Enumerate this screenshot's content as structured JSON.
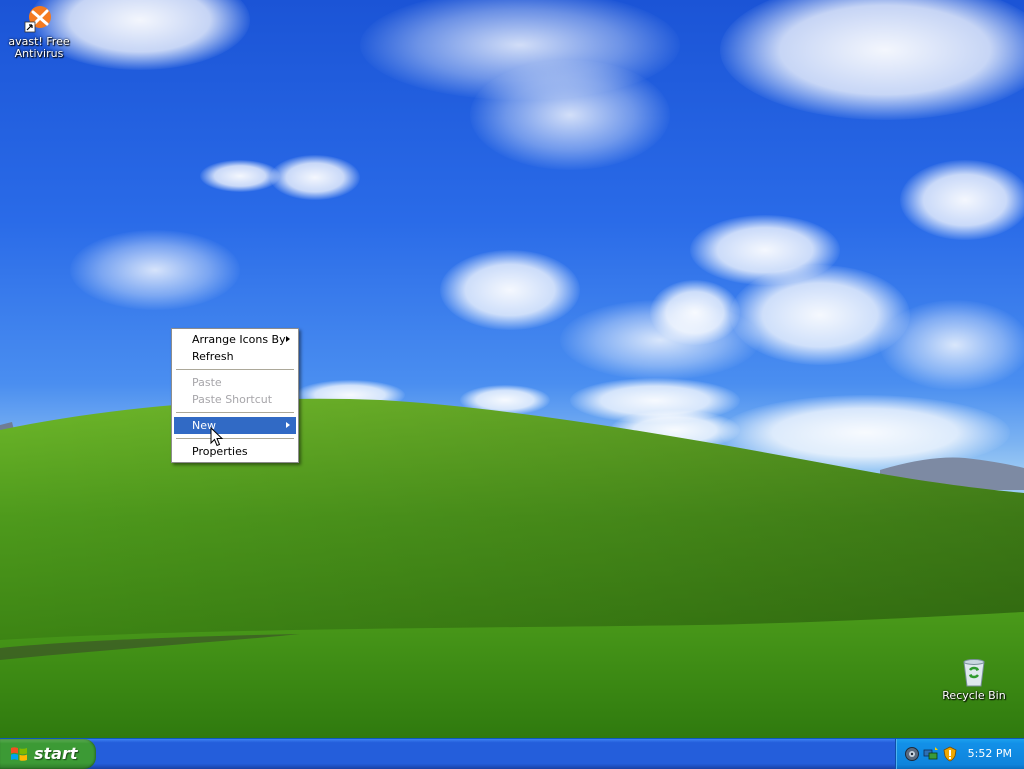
{
  "desktop": {
    "icons": [
      {
        "label": "avast! Free Antivirus",
        "icon": "avast-antivirus-icon"
      },
      {
        "label": "Recycle Bin",
        "icon": "recycle-bin-icon"
      }
    ]
  },
  "context_menu": {
    "items": [
      {
        "label": "Arrange Icons By",
        "submenu": true,
        "enabled": true
      },
      {
        "label": "Refresh",
        "enabled": true
      },
      {
        "label": "Paste",
        "enabled": false
      },
      {
        "label": "Paste Shortcut",
        "enabled": false
      },
      {
        "label": "New",
        "submenu": true,
        "enabled": true,
        "highlighted": true
      },
      {
        "label": "Properties",
        "enabled": true
      }
    ],
    "highlight_color": "#316ac5",
    "disabled_color": "#a7a6aa"
  },
  "taskbar": {
    "start_label": "start",
    "tray_icons": [
      "volume-icon",
      "network-icon",
      "security-alert-icon"
    ],
    "clock": "5:52 PM",
    "taskbar_color": "#245edb",
    "start_color": "#3c9a35",
    "tray_color": "#0f84dc"
  }
}
